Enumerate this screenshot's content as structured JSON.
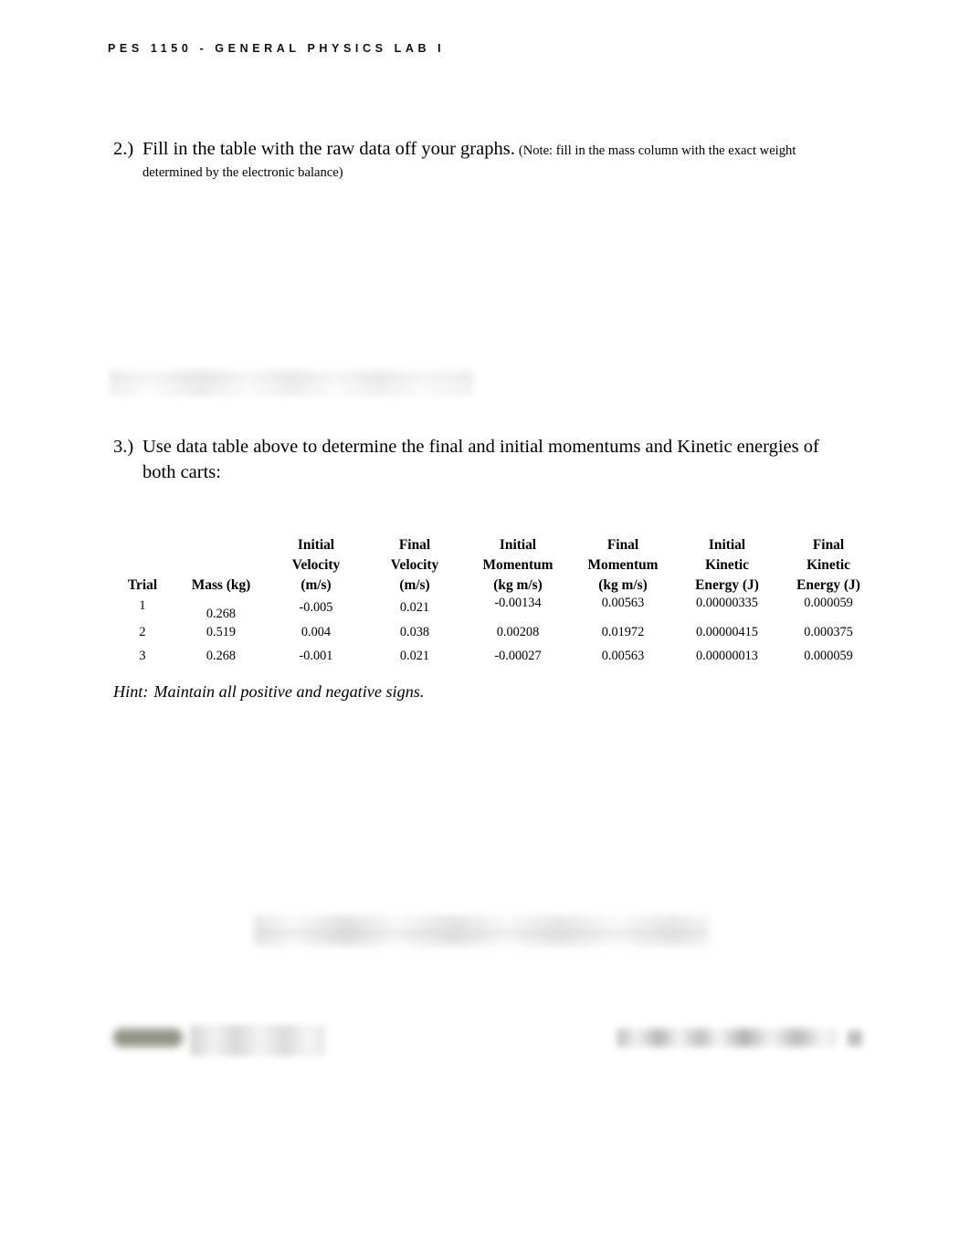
{
  "header": {
    "running_title": "PES 1150 - GENERAL PHYSICS LAB I"
  },
  "questions": [
    {
      "number": "2.)",
      "main_text": "Fill in the table with the raw data off your graphs.",
      "note_text": "(Note: fill in the mass column with the exact weight",
      "continuation": "determined by the electronic balance)"
    },
    {
      "number": "3.)",
      "main_text": "Use data table above to determine the final and initial momentums and Kinetic energies of",
      "note_text": "",
      "continuation": "both carts:"
    }
  ],
  "data_table": {
    "headers": [
      "Trial",
      "Mass (kg)",
      "Initial\nVelocity\n(m/s)",
      "Final\nVelocity\n(m/s)",
      "Initial\nMomentum\n(kg m/s)",
      "Final\nMomentum\n(kg m/s)",
      "Initial\nKinetic\nEnergy (J)",
      "Final\nKinetic\nEnergy (J)"
    ],
    "rows": [
      {
        "trial": "1",
        "mass": "0.268",
        "initial_velocity": "-0.005",
        "final_velocity": "0.021",
        "initial_momentum": "-0.00134",
        "final_momentum": "0.00563",
        "initial_kinetic_energy": "0.00000335",
        "final_kinetic_energy": "0.000059"
      },
      {
        "trial": "2",
        "mass": "0.519",
        "initial_velocity": "0.004",
        "final_velocity": "0.038",
        "initial_momentum": "0.00208",
        "final_momentum": "0.01972",
        "initial_kinetic_energy": "0.00000415",
        "final_kinetic_energy": "0.000375"
      },
      {
        "trial": "3",
        "mass": "0.268",
        "initial_velocity": "-0.001",
        "final_velocity": "0.021",
        "initial_momentum": "-0.00027",
        "final_momentum": "0.00563",
        "initial_kinetic_energy": "0.00000013",
        "final_kinetic_energy": "0.000059"
      }
    ]
  },
  "hint": {
    "label": "Hint:",
    "text": "Maintain all positive and negative signs."
  },
  "colors": {
    "text": "#000000",
    "page_background": "#ffffff",
    "footer_logo_blur": "#8b8a7c"
  }
}
